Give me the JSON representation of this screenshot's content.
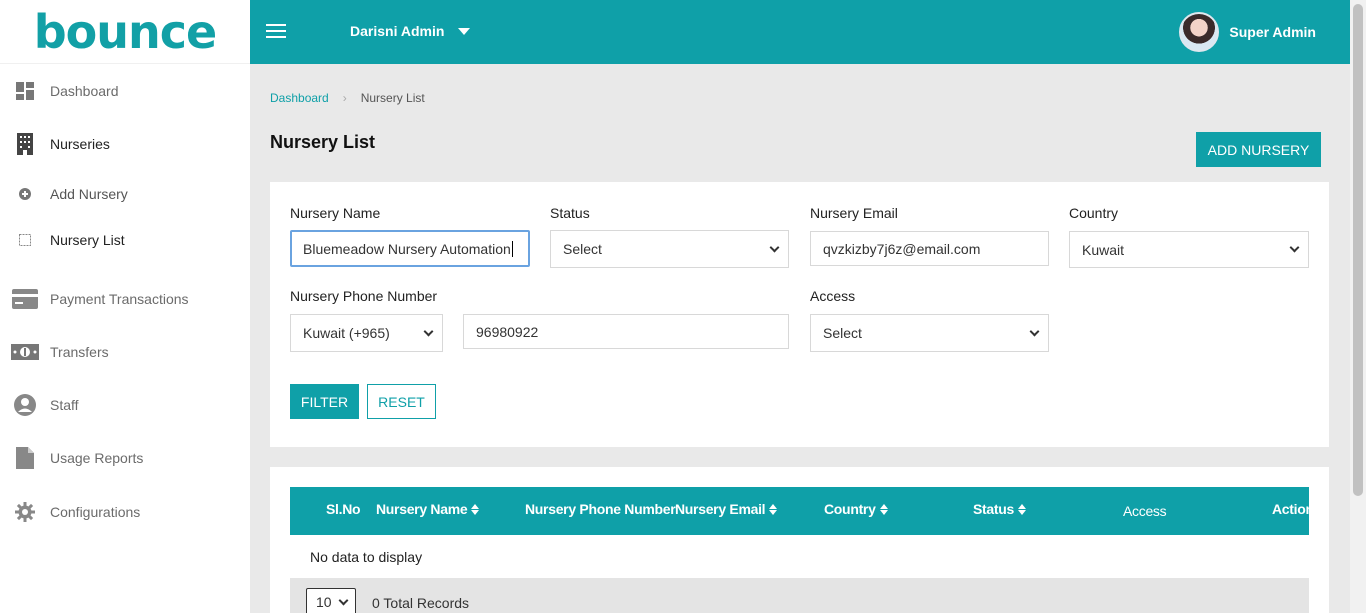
{
  "app": {
    "logo_text": "bounce",
    "brand_color": "#0fa0a8"
  },
  "sidebar": {
    "items": [
      {
        "label": "Dashboard",
        "icon": "dashboard-icon"
      },
      {
        "label": "Nurseries",
        "icon": "building-icon"
      },
      {
        "label": "Add Nursery",
        "icon": "plus-circle-icon"
      },
      {
        "label": "Nursery List",
        "icon": "list-icon"
      },
      {
        "label": "Payment Transactions",
        "icon": "credit-card-icon"
      },
      {
        "label": "Transfers",
        "icon": "money-icon"
      },
      {
        "label": "Staff",
        "icon": "user-icon"
      },
      {
        "label": "Usage Reports",
        "icon": "file-icon"
      },
      {
        "label": "Configurations",
        "icon": "gear-icon"
      }
    ]
  },
  "topbar": {
    "org_name": "Darisni Admin",
    "user_name": "Super Admin"
  },
  "breadcrumb": {
    "home": "Dashboard",
    "current": "Nursery List"
  },
  "page": {
    "title": "Nursery List",
    "add_button": "ADD NURSERY"
  },
  "filters": {
    "nursery_name": {
      "label": "Nursery Name",
      "value": "Bluemeadow Nursery Automation"
    },
    "status": {
      "label": "Status",
      "value": "Select"
    },
    "nursery_email": {
      "label": "Nursery Email",
      "value": "qvzkizby7j6z@email.com"
    },
    "country": {
      "label": "Country",
      "value": "Kuwait"
    },
    "phone": {
      "label": "Nursery Phone Number",
      "code_value": "Kuwait (+965)",
      "value": "96980922"
    },
    "access": {
      "label": "Access",
      "value": "Select"
    },
    "filter_button": "FILTER",
    "reset_button": "RESET"
  },
  "table": {
    "columns": [
      "Sl.No",
      "Nursery Name",
      "Nursery Phone Number",
      "Nursery Email",
      "Country",
      "Status",
      "Access",
      "Action"
    ],
    "empty_text": "No data to display",
    "page_size": "10",
    "total_records": "0 Total Records"
  }
}
